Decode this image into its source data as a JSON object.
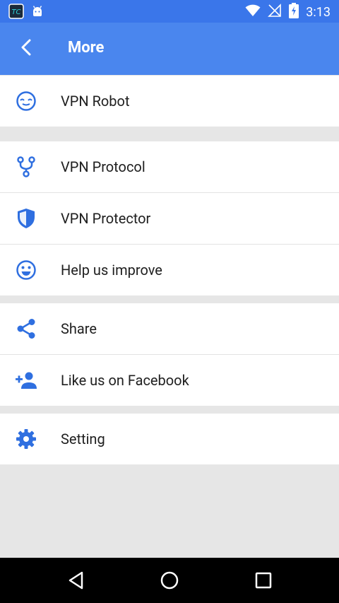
{
  "status_bar": {
    "time": "3:13",
    "icons": [
      "tc-app-icon",
      "android-icon",
      "wifi-icon",
      "no-signal-icon",
      "battery-charging-icon"
    ]
  },
  "app_bar": {
    "title": "More",
    "back_icon": "chevron-left-icon"
  },
  "colors": {
    "status_bar": "#3a76ea",
    "app_bar": "#4a86ee",
    "icon_blue": "#2f6fe0",
    "background": "#e6e6e6"
  },
  "menu": {
    "groups": [
      {
        "items": [
          {
            "label": "VPN Robot",
            "icon": "robot-face-icon"
          }
        ]
      },
      {
        "items": [
          {
            "label": "VPN Protocol",
            "icon": "fork-icon"
          },
          {
            "label": "VPN Protector",
            "icon": "shield-icon"
          },
          {
            "label": "Help us improve",
            "icon": "smiley-icon"
          }
        ]
      },
      {
        "items": [
          {
            "label": "Share",
            "icon": "share-icon"
          },
          {
            "label": "Like us on Facebook",
            "icon": "add-person-icon"
          }
        ]
      },
      {
        "items": [
          {
            "label": "Setting",
            "icon": "gear-icon"
          }
        ]
      }
    ]
  },
  "nav_bar": {
    "buttons": [
      "back-triangle-icon",
      "home-circle-icon",
      "recents-square-icon"
    ]
  }
}
